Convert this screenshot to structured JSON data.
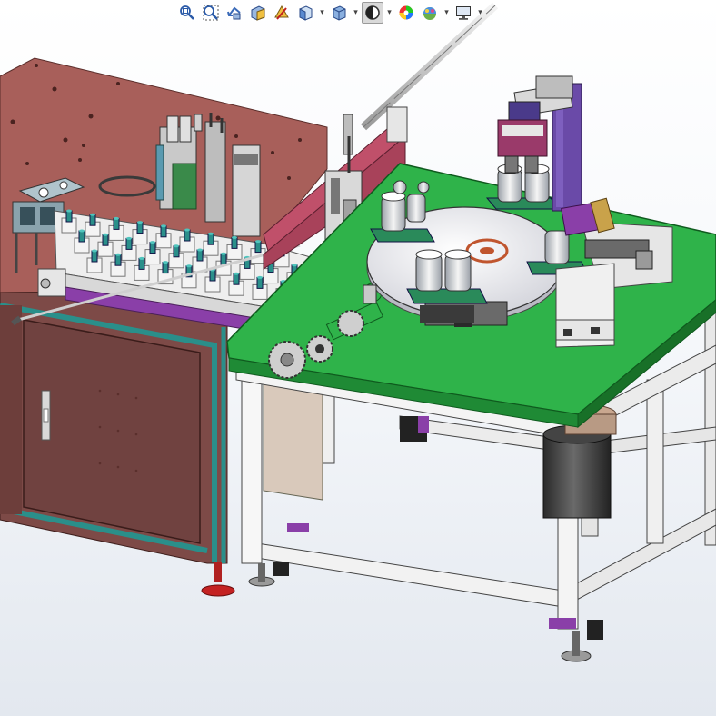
{
  "toolbar": {
    "items": [
      {
        "icon": "zoom-to-fit-icon",
        "has_menu": false,
        "active": false
      },
      {
        "icon": "zoom-to-area-icon",
        "has_menu": false,
        "active": false
      },
      {
        "icon": "previous-view-icon",
        "has_menu": false,
        "active": false
      },
      {
        "icon": "section-view-icon",
        "has_menu": false,
        "active": false
      },
      {
        "icon": "dynamic-annotation-views-icon",
        "has_menu": false,
        "active": false
      },
      {
        "icon": "view-orientation-icon",
        "has_menu": true,
        "active": false
      },
      {
        "icon": "display-style-icon",
        "has_menu": true,
        "active": false
      },
      {
        "icon": "hide-show-items-icon",
        "has_menu": true,
        "active": true
      },
      {
        "icon": "edit-appearance-icon",
        "has_menu": false,
        "active": false
      },
      {
        "icon": "apply-scene-icon",
        "has_menu": true,
        "active": false
      },
      {
        "icon": "view-settings-icon",
        "has_menu": true,
        "active": false
      }
    ]
  },
  "colors": {
    "table_top": "#2fb34a",
    "frame": "#ededed",
    "cabinet": "#7d4a47",
    "cabinet_top": "#a85f5a",
    "cabinet_trim": "#2a8f8a",
    "accent_purple": "#8a3fa8",
    "turntable": "#e9e9ee",
    "manipulator": "#6a4aa8"
  }
}
